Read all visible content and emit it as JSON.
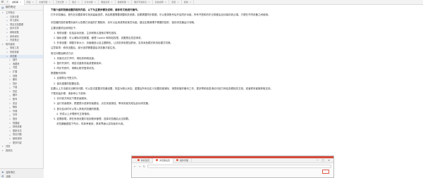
{
  "tabbar": {
    "tabs": [
      {
        "label": "资料库",
        "active": true
      },
      {
        "label": "阅读"
      },
      {
        "label": "文章管理"
      },
      {
        "label": "工作记录"
      },
      {
        "label": "笔记"
      },
      {
        "label": "分享内容"
      },
      {
        "label": "网络资源"
      },
      {
        "label": "数据整理"
      },
      {
        "label": "程序开发笔记"
      },
      {
        "label": "系统说明"
      },
      {
        "label": "配置"
      },
      {
        "label": "其他"
      }
    ]
  },
  "sidebar": {
    "title": "我的笔记",
    "items": [
      {
        "label": "工作笔记",
        "level": 1
      },
      {
        "label": "日常记录",
        "level": 2
      },
      {
        "label": "学习资料",
        "level": 2
      },
      {
        "label": "项目文档整理",
        "level": 2
      },
      {
        "label": "技术文章",
        "level": 2
      },
      {
        "label": "网络收集",
        "level": 2
      },
      {
        "label": "参考资料",
        "level": 2
      },
      {
        "label": "开发笔记",
        "level": 2
      },
      {
        "label": "软件使用",
        "level": 1
      },
      {
        "label": "常用工具",
        "level": 2
      },
      {
        "label": "系统设置",
        "level": 2
      },
      {
        "label": "浏览器",
        "level": 2,
        "selected": true
      },
      {
        "label": "插件",
        "level": 3
      },
      {
        "label": "收藏夹",
        "level": 3
      },
      {
        "label": "书签",
        "level": 3
      },
      {
        "label": "扩展",
        "level": 3
      },
      {
        "label": "设置",
        "level": 3
      },
      {
        "label": "备份",
        "level": 3
      },
      {
        "label": "同步",
        "level": 3
      },
      {
        "label": "下载",
        "level": 3
      },
      {
        "label": "历史",
        "level": 3
      },
      {
        "label": "缓存",
        "level": 3
      },
      {
        "label": "账号",
        "level": 3
      },
      {
        "label": "安全",
        "level": 3
      },
      {
        "label": "隐私",
        "level": 3
      },
      {
        "label": "外观",
        "level": 3
      },
      {
        "label": "字体",
        "level": 3
      },
      {
        "label": "语言",
        "level": 3
      },
      {
        "label": "快捷键",
        "level": 3
      },
      {
        "label": "其他设置",
        "level": 3
      },
      {
        "label": "更新日志",
        "level": 3
      },
      {
        "label": "常见问题",
        "level": 3
      },
      {
        "label": "使用说明",
        "level": 3
      },
      {
        "label": "更多内容",
        "level": 3
      },
      {
        "label": "归档",
        "level": 1
      },
      {
        "label": "回收站",
        "level": 1
      }
    ],
    "footer": [
      {
        "icon": "★",
        "label": "星标笔记"
      },
      {
        "icon": "⚙",
        "label": "设置"
      }
    ]
  },
  "document": {
    "lines": [
      {
        "text": "下面介绍浏览器设置的相关内容，以下为主要步骤及说明，请参考文档进行操作。",
        "style": "head"
      },
      {
        "text": "打开浏览器后，首先在设置菜单中找到高级选项，然后根据需要调整相关参数。如果需要同步数据，可以登录账号后开启同步功能，所有书签和历史记录都会自动保存到云端，方便在不同设备之间使用。",
        "style": "wrap"
      },
      {
        "text": "浏览器的插件管理页面可以查看已安装的扩展程序，也可以启用或禁用某些功能。建议定期清理不需要的插件，保持浏览器运行流畅。"
      },
      {
        "text": "主要设置项目说明如下：",
        "style": "gap"
      },
      {
        "text": "1. 常规设置：包括启动页面、主页和默认搜索引擎的选择。",
        "style": "ind"
      },
      {
        "text": "2. 隐私设置：可以清除浏览数据，管理 Cookie 和网站权限，设置是否发送请求。",
        "style": "ind"
      },
      {
        "text": "3. 外观设置：调整字体大小、页面缩放以及主题颜色，让浏览体验更加舒适，支持深色模式和浅色模式切换。",
        "style": "ind"
      },
      {
        "text": "注意事项：修改设置后，部分选项需要重启浏览器才能生效。",
        "style": "gap"
      },
      {
        "text": "常见问题及解决方法：",
        "style": "gap"
      },
      {
        "text": "1. 页面无法打开时，请检查网络连接。",
        "style": "ind"
      },
      {
        "text": "2. 插件失效时，请尝试重新安装或更新版本。",
        "style": "ind"
      },
      {
        "text": "3. 同步失败时，请确认账号登录状态。",
        "style": "ind"
      },
      {
        "text": "数据备份说明：",
        "style": "gap"
      },
      {
        "text": "1. 定期导出书签文件。",
        "style": "ind"
      },
      {
        "text": "2. 保存重要的配置信息。",
        "style": "ind"
      },
      {
        "text": "如果以上方法都无法解决问题，可以尝试重置浏览器设置，恢复为默认状态。重置后所有自定义设置将被清除，请提前做好备份工作。更多帮助信息请访问官方网站查看相关文档，或者联系客服获取支持。",
        "style": "gap"
      },
      {
        "text": "下载安装步骤，请参考以下说明：",
        "style": "gap"
      },
      {
        "text": "1. 访问官方网站下载安装程序。",
        "style": "ind"
      },
      {
        "text": "2. 运行安装程序，根据提示选择安装路径，点击安装按钮，等待安装完成后启动浏览器。",
        "style": "ind"
      },
      {
        "text": "3. 首次启动时可以导入其他浏览器的数据。",
        "style": "ind"
      },
      {
        "text": "4. 完成以上步骤即可正常使用。",
        "style": "ind2"
      },
      {
        "text": "5. 如需卸载，请在系统设置中找到程序管理，选择浏览器后点击卸载。",
        "style": "ind"
      },
      {
        "text": "浏览器截图如下所示，供参考使用，具体界面以实际版本为准。",
        "style": "ind2"
      }
    ]
  },
  "embed": {
    "tabs": [
      {
        "label": "新标签页"
      },
      {
        "label": "浏览器设置"
      },
      {
        "label": "插件管理"
      }
    ],
    "url": "",
    "window_controls": "─ □ ✕"
  },
  "colors": {
    "accent": "#d64b3c",
    "selection": "#e1e9f5"
  }
}
